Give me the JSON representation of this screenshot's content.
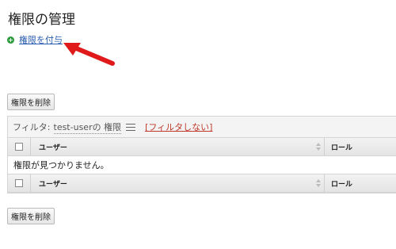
{
  "page": {
    "title": "権限の管理",
    "grant_link": "権限を付与"
  },
  "buttons": {
    "remove_label": "権限を削除"
  },
  "filter": {
    "prefix": "フィルタ:",
    "value": "test-userの 権限",
    "no_filter_label": "[フィルタしない]"
  },
  "table": {
    "columns": [
      "ユーザー",
      "ロール"
    ],
    "empty_message": "権限が見つかりません。"
  },
  "colors": {
    "link": "#2a5db0",
    "no_filter": "#c0392b",
    "add_icon": "#2c9b3a",
    "annotation_arrow": "#e01a1a"
  }
}
